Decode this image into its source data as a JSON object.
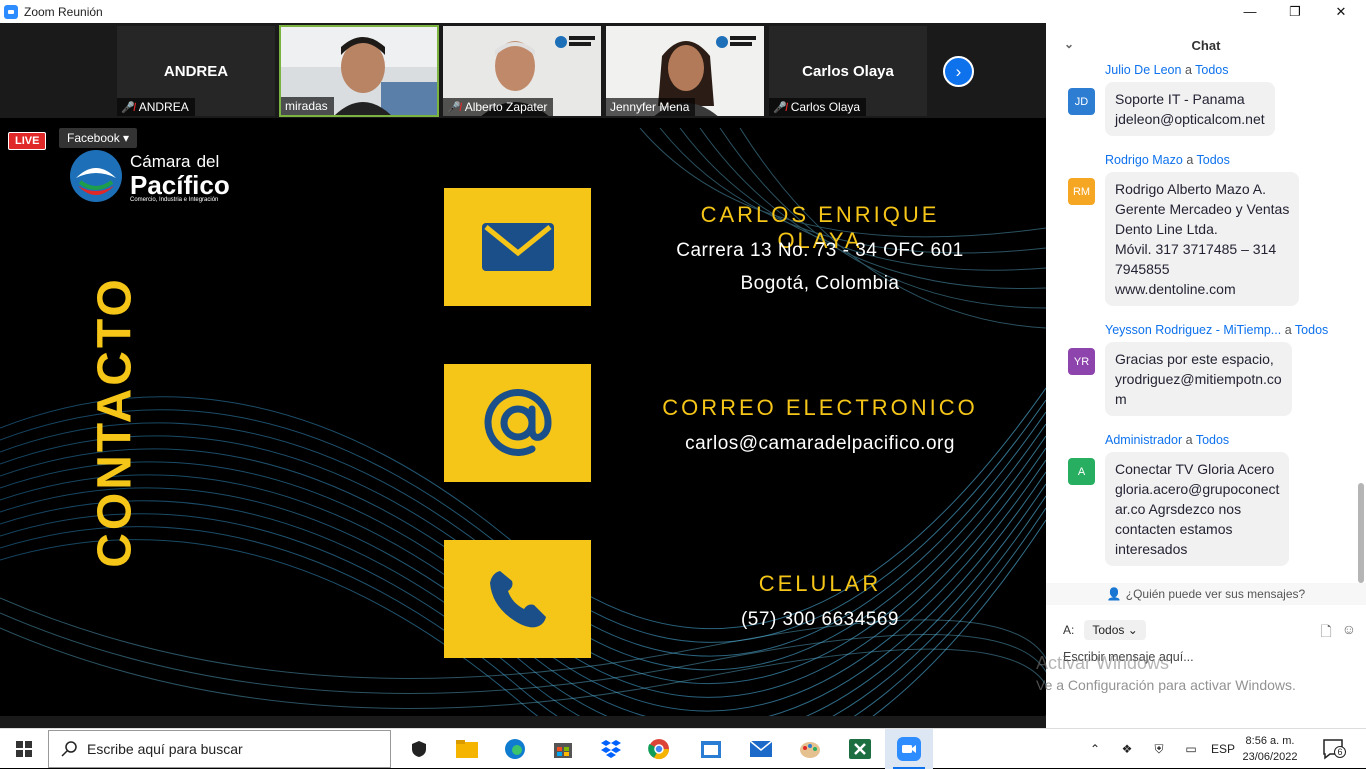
{
  "window": {
    "title": "Zoom Reunión",
    "minimize": "—",
    "maximize": "❐",
    "close": "✕"
  },
  "participants": [
    {
      "big_name": "ANDREA",
      "tag": "ANDREA",
      "muted": true,
      "video": false
    },
    {
      "big_name": "",
      "tag": "miradas",
      "muted": false,
      "video": true
    },
    {
      "big_name": "",
      "tag": "Alberto Zapater",
      "muted": true,
      "video": true
    },
    {
      "big_name": "",
      "tag": "Jennyfer Mena",
      "muted": false,
      "video": true
    },
    {
      "big_name": "Carlos Olaya",
      "tag": "Carlos Olaya",
      "muted": true,
      "video": false
    }
  ],
  "live": {
    "badge": "LIVE",
    "platform": "Facebook"
  },
  "slide": {
    "logo_line1": "Cámara",
    "logo_line1_b": "del",
    "logo_line2": "Pacífico",
    "logo_line3": "Comercio, Industria e Integración",
    "vertical_title": "CONTACTO",
    "contact_name": "CARLOS ENRIQUE OLAYA",
    "address1": "Carrera 13 No. 73 - 34 OFC 601",
    "address2": "Bogotá, Colombia",
    "email_title": "CORREO ELECTRONICO",
    "email": "carlos@camaradelpacifico.org",
    "phone_title": "CELULAR",
    "phone": "(57) 300 6634569",
    "colors": {
      "accent": "#f5c518",
      "icon": "#1b4f8a"
    }
  },
  "chat": {
    "title": "Chat",
    "messages": [
      {
        "from": "Julio De Leon",
        "to": "Todos",
        "initials": "JD",
        "color": "#2d7dd2",
        "text": [
          "Soporte IT - Panama",
          "jdeleon@opticalcom.net"
        ]
      },
      {
        "from": "Rodrigo Mazo",
        "to": "Todos",
        "initials": "RM",
        "color": "#f5a623",
        "text": [
          "Rodrigo Alberto Mazo A.",
          "Gerente Mercadeo y Ventas",
          "Dento Line Ltda.",
          "Móvil. 317 3717485 – 314",
          "7945855",
          "www.dentoline.com"
        ]
      },
      {
        "from": "Yeysson Rodriguez - MiTiemp...",
        "to": "Todos",
        "initials": "YR",
        "color": "#8e44ad",
        "text": [
          "Gracias por este espacio,",
          "yrodriguez@mitiempotn.co",
          "m"
        ]
      },
      {
        "from": "Administrador",
        "to": "Todos",
        "initials": "A",
        "color": "#27ae60",
        "text": [
          "Conectar TV Gloria Acero",
          "gloria.acero@grupoconect",
          "ar.co Agrsdezco nos",
          "contacten estamos",
          "interesados"
        ]
      }
    ],
    "to_word": "a",
    "who_can_see": "¿Quién puede ver sus mensajes?",
    "to_label": "A:",
    "recipient": "Todos",
    "placeholder": "Escribir mensaje aquí..."
  },
  "watermark": {
    "line1": "Activar Windows",
    "line2": "Ve a Configuración para activar Windows."
  },
  "taskbar": {
    "search_placeholder": "Escribe aquí para buscar",
    "apps": [
      "task-view",
      "file-explorer",
      "edge",
      "store",
      "dropbox",
      "chrome",
      "outlook-calendar",
      "mail",
      "paint",
      "excel",
      "zoom"
    ],
    "language": "ESP",
    "time": "8:56 a. m.",
    "date": "23/06/2022",
    "notifications": "6"
  }
}
